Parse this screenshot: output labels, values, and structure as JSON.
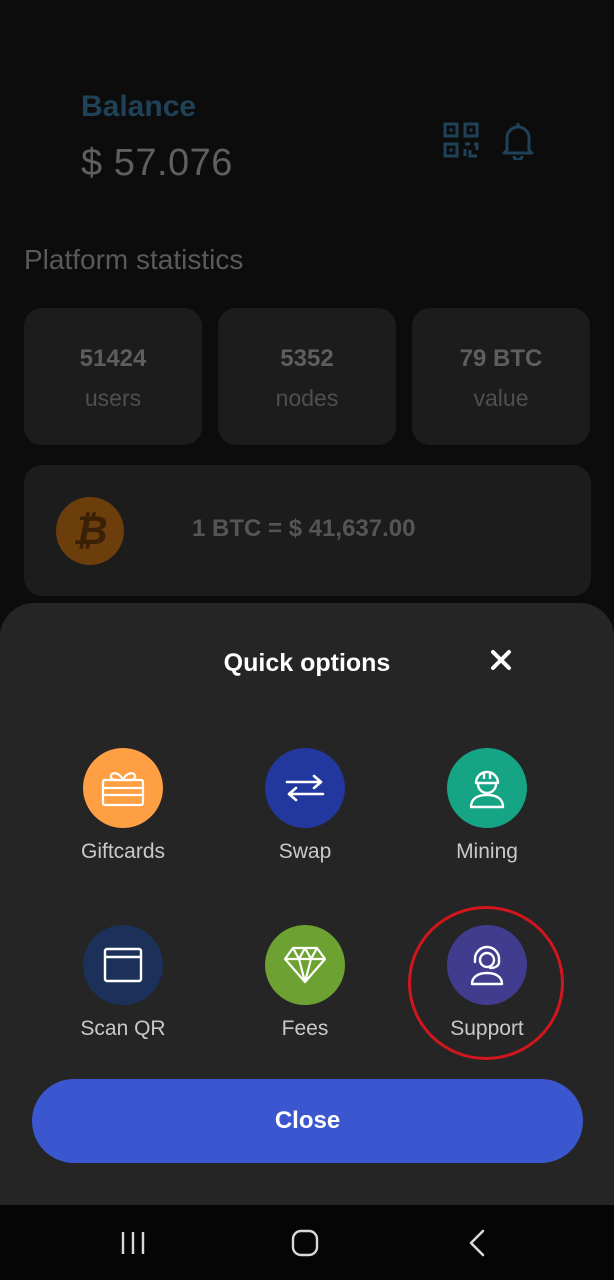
{
  "header": {
    "balance_label": "Balance",
    "balance_value": "$ 57.076",
    "qr_icon": "qr-code-icon",
    "bell_icon": "bell-icon"
  },
  "statistics": {
    "title": "Platform statistics",
    "cards": [
      {
        "value": "51424",
        "label": "users"
      },
      {
        "value": "5352",
        "label": "nodes"
      },
      {
        "value": "79 BTC",
        "label": "value"
      }
    ],
    "price": {
      "coin_icon": "bitcoin-icon",
      "text": "1 BTC = $ 41,637.00"
    }
  },
  "sheet": {
    "title": "Quick options",
    "close_icon": "close-icon",
    "options": [
      {
        "label": "Giftcards",
        "icon": "gift-card-icon",
        "color": "#ff9f43"
      },
      {
        "label": "Swap",
        "icon": "swap-arrows-icon",
        "color": "#22389e"
      },
      {
        "label": "Mining",
        "icon": "miner-helmet-icon",
        "color": "#16a584"
      },
      {
        "label": "Scan QR",
        "icon": "browser-window-icon",
        "color": "#1c3159"
      },
      {
        "label": "Fees",
        "icon": "diamond-icon",
        "color": "#6da232"
      },
      {
        "label": "Support",
        "icon": "headset-support-icon",
        "color": "#423c8f"
      }
    ],
    "close_button_label": "Close"
  },
  "navbar": {
    "recents_icon": "recents-icon",
    "home_icon": "home-icon",
    "back_icon": "back-icon"
  },
  "colors": {
    "accent_blue": "#3a57cf",
    "highlight_red": "#d1161d",
    "sheet_background": "#252525"
  }
}
